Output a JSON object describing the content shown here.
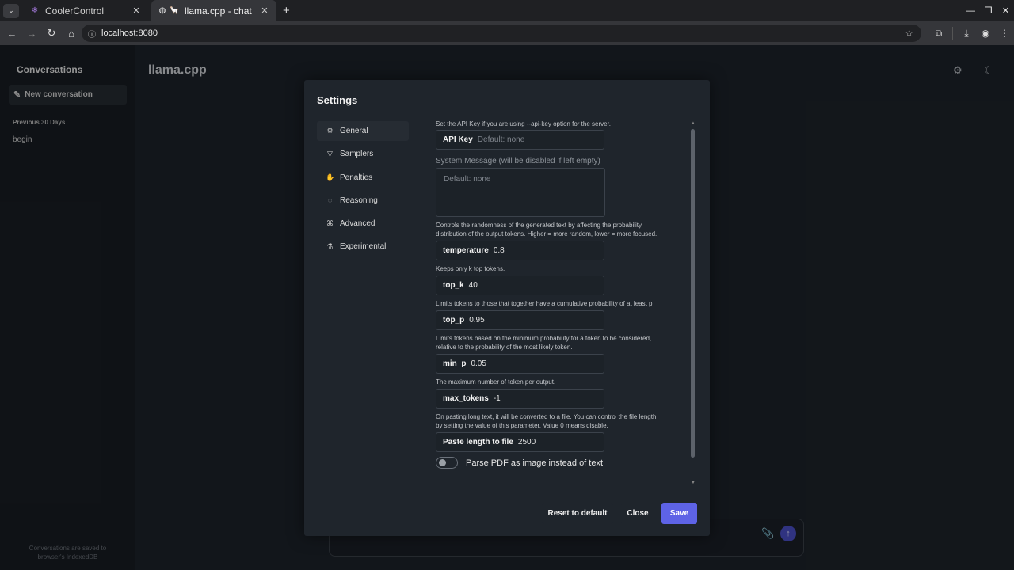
{
  "browser": {
    "tabs": [
      {
        "title": "CoolerControl",
        "icon": "coolercontrol-icon"
      },
      {
        "title": "llama.cpp - chat",
        "icon": "llama-icon"
      }
    ],
    "url": "localhost:8080"
  },
  "sidebar": {
    "title": "Conversations",
    "new_conversation": "New conversation",
    "section_label": "Previous 30 Days",
    "conversations": [
      "begin"
    ],
    "footer_line1": "Conversations are saved to",
    "footer_line2": "browser's IndexedDB"
  },
  "app": {
    "title": "llama.cpp"
  },
  "settings": {
    "title": "Settings",
    "menu": [
      "General",
      "Samplers",
      "Penalties",
      "Reasoning",
      "Advanced",
      "Experimental"
    ],
    "api_key": {
      "desc": "Set the API Key if you are using --api-key option for the server.",
      "label": "API Key",
      "placeholder": "Default: none"
    },
    "system_message": {
      "label": "System Message (will be disabled if left empty)",
      "placeholder": "Default: none"
    },
    "temperature": {
      "desc1": "Controls the randomness of the generated text by affecting the probability",
      "desc2": "distribution of the output tokens. Higher = more random, lower = more focused.",
      "label": "temperature",
      "value": "0.8"
    },
    "top_k": {
      "desc": "Keeps only k top tokens.",
      "label": "top_k",
      "value": "40"
    },
    "top_p": {
      "desc": "Limits tokens to those that together have a cumulative probability of at least p",
      "label": "top_p",
      "value": "0.95"
    },
    "min_p": {
      "desc1": "Limits tokens based on the minimum probability for a token to be considered,",
      "desc2": "relative to the probability of the most likely token.",
      "label": "min_p",
      "value": "0.05"
    },
    "max_tokens": {
      "desc": "The maximum number of token per output.",
      "label": "max_tokens",
      "value": "-1"
    },
    "paste_length": {
      "desc1": "On pasting long text, it will be converted to a file. You can control the file length",
      "desc2": "by setting the value of this parameter. Value 0 means disable.",
      "label": "Paste length to file",
      "value": "2500"
    },
    "parse_pdf": {
      "label": "Parse PDF as image instead of text",
      "enabled": false
    },
    "buttons": {
      "reset": "Reset to default",
      "close": "Close",
      "save": "Save"
    }
  }
}
